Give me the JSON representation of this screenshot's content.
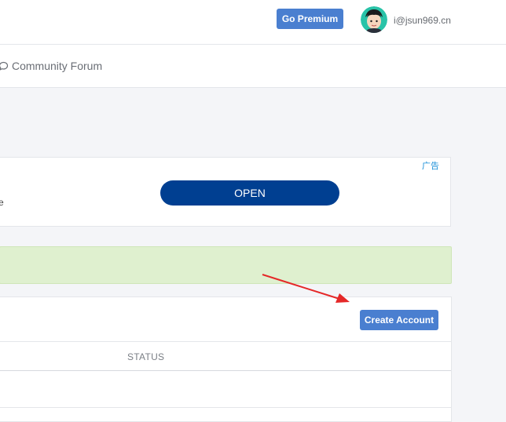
{
  "header": {
    "premium_label": "Go Premium",
    "user_email": "i@jsun969.cn",
    "avatar_icon": "avatar-icon"
  },
  "nav": {
    "forum_label": "Community Forum",
    "forum_icon": "chat-bubble-icon"
  },
  "ad": {
    "label": "广告",
    "fragment": "e",
    "open_label": "OPEN"
  },
  "alert": {
    "text": ""
  },
  "panel": {
    "create_label": "Create Account",
    "columns": [
      "STATUS"
    ]
  },
  "colors": {
    "primary_button": "#4a7fd0",
    "open_button": "#003f91",
    "alert_bg": "#dff0cf",
    "annotation_arrow": "#e52828"
  }
}
